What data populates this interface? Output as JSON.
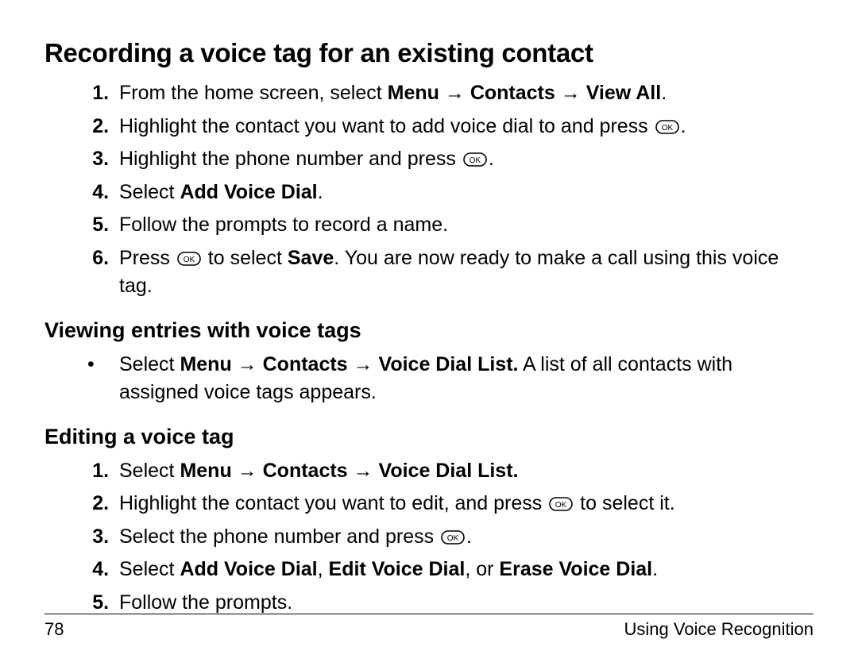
{
  "title": "Recording a voice tag for an existing contact",
  "arrow": "→",
  "labels": {
    "menu": "Menu",
    "contacts": "Contacts",
    "view_all": "View All",
    "add_voice_dial": "Add Voice Dial",
    "edit_voice_dial": "Edit Voice Dial",
    "erase_voice_dial": "Erase Voice Dial",
    "voice_dial_list": "Voice Dial List",
    "save": "Save"
  },
  "section1": {
    "s1_pre": "From the home screen, select ",
    "s1_post": ".",
    "s2_a": "Highlight the contact you want to add voice dial to and press ",
    "s2_b": ".",
    "s3_a": "Highlight the phone number and press ",
    "s3_b": ".",
    "s4_a": "Select ",
    "s4_b": ".",
    "s5": "Follow the prompts to record a name.",
    "s6_a": "Press ",
    "s6_b": " to select ",
    "s6_c": ". You are now ready to make a call using this voice tag."
  },
  "subhead_view": "Viewing entries with voice tags",
  "view_item": {
    "a": "Select ",
    "b": " A list of all contacts with assigned voice tags appears."
  },
  "subhead_edit": "Editing a voice tag",
  "section3": {
    "s1_a": "Select ",
    "s2_a": "Highlight the contact you want to edit, and press ",
    "s2_b": " to select it.",
    "s3_a": "Select the phone number and press ",
    "s3_b": ".",
    "s4_a": "Select ",
    "s4_sep1": ", ",
    "s4_sep2": ", or ",
    "s4_end": ".",
    "s5": "Follow the prompts."
  },
  "footer": {
    "page": "78",
    "chapter": "Using Voice Recognition"
  }
}
